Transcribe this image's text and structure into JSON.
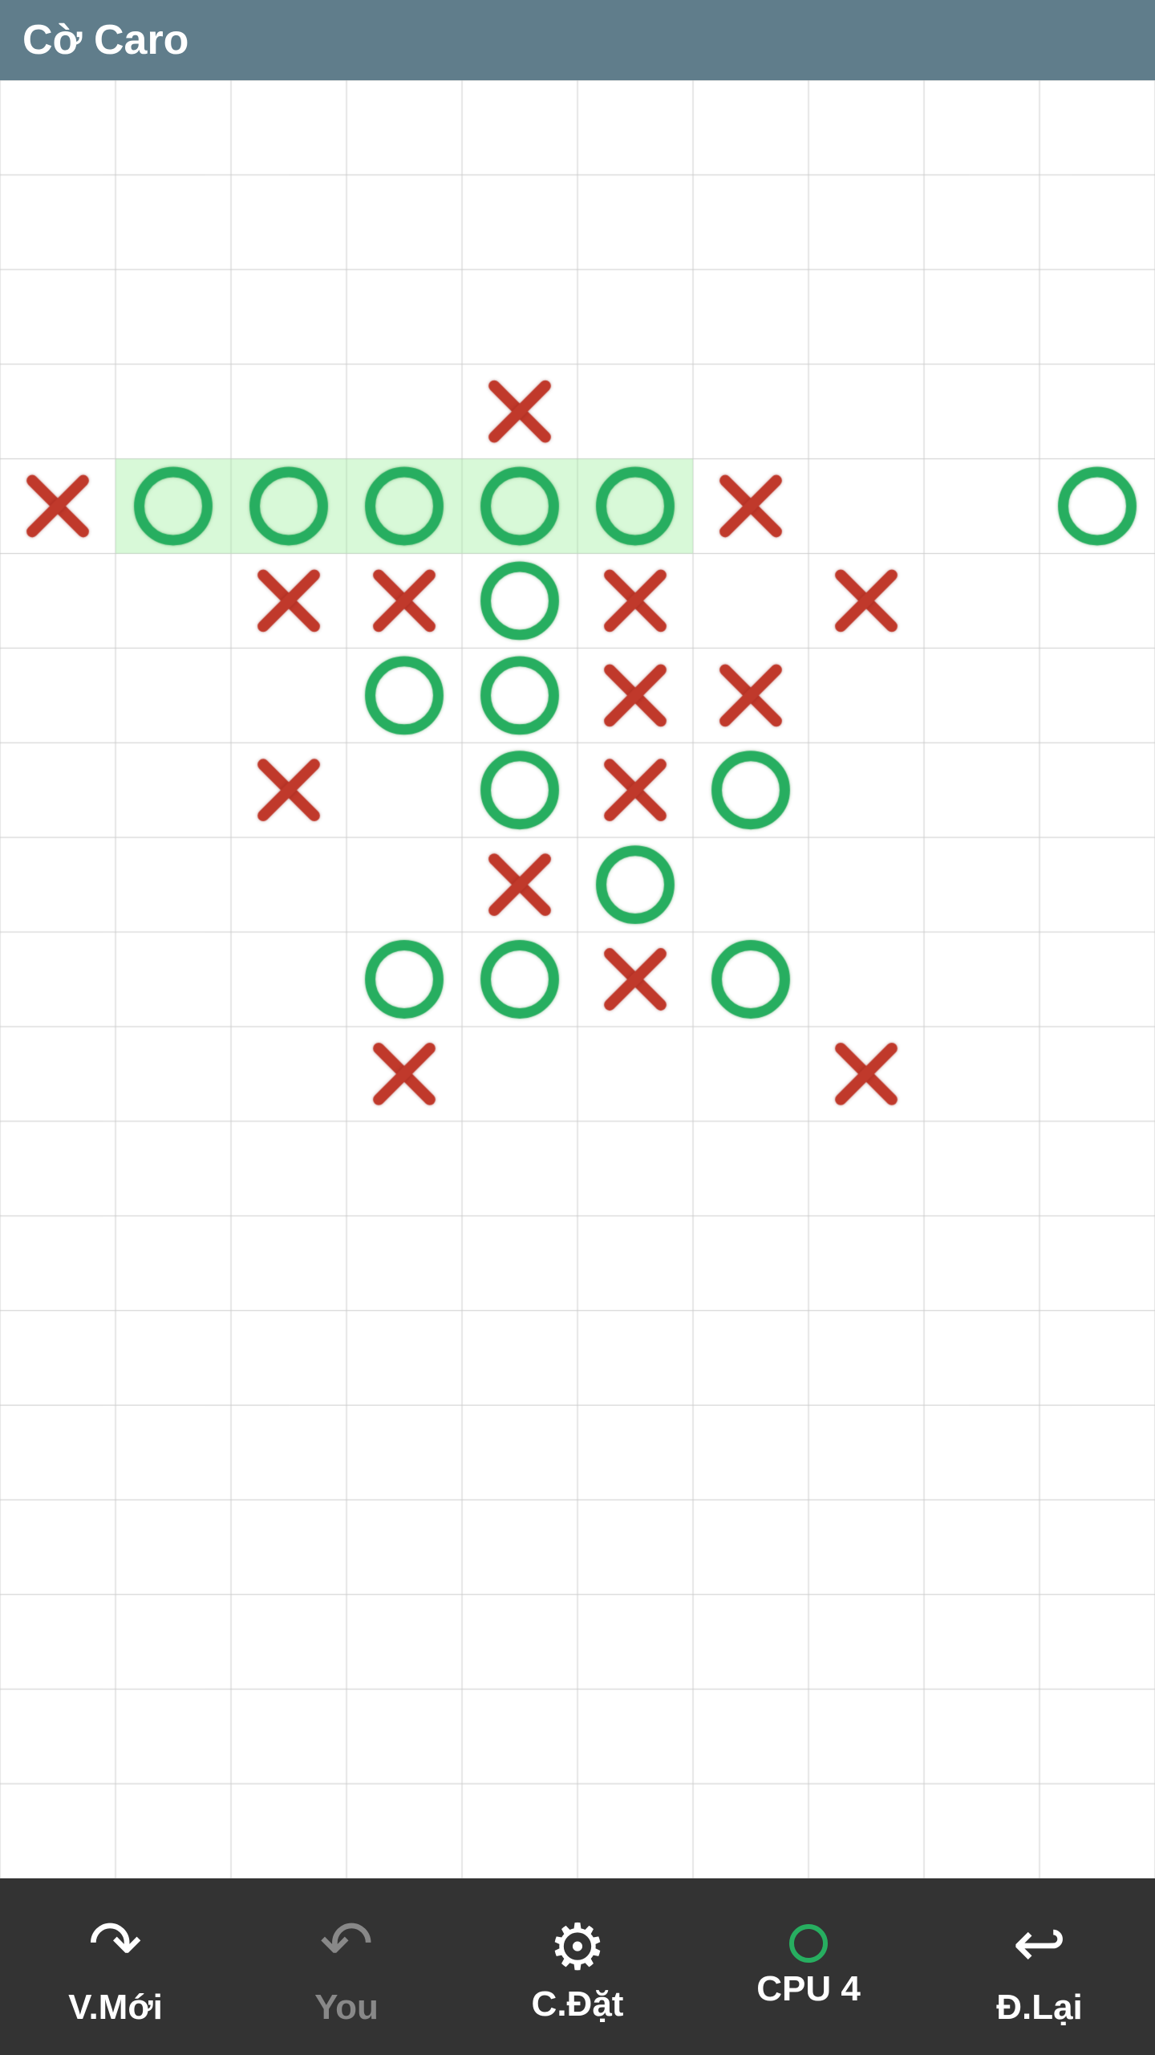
{
  "app": {
    "title": "Cờ Caro"
  },
  "board": {
    "cols": 10,
    "rows": 19,
    "cellSize": 144,
    "pieces": [
      {
        "row": 3,
        "col": 4,
        "type": "X"
      },
      {
        "row": 4,
        "col": 0,
        "type": "X"
      },
      {
        "row": 4,
        "col": 1,
        "type": "O",
        "highlight": true
      },
      {
        "row": 4,
        "col": 2,
        "type": "O",
        "highlight": true
      },
      {
        "row": 4,
        "col": 3,
        "type": "O",
        "highlight": true
      },
      {
        "row": 4,
        "col": 4,
        "type": "O",
        "highlight": true
      },
      {
        "row": 4,
        "col": 5,
        "type": "O",
        "highlight": true
      },
      {
        "row": 4,
        "col": 6,
        "type": "X"
      },
      {
        "row": 4,
        "col": 9,
        "type": "O"
      },
      {
        "row": 5,
        "col": 2,
        "type": "X"
      },
      {
        "row": 5,
        "col": 3,
        "type": "X"
      },
      {
        "row": 5,
        "col": 4,
        "type": "O"
      },
      {
        "row": 5,
        "col": 5,
        "type": "X"
      },
      {
        "row": 5,
        "col": 7,
        "type": "X"
      },
      {
        "row": 6,
        "col": 3,
        "type": "O"
      },
      {
        "row": 6,
        "col": 4,
        "type": "O"
      },
      {
        "row": 6,
        "col": 5,
        "type": "X"
      },
      {
        "row": 6,
        "col": 6,
        "type": "X"
      },
      {
        "row": 7,
        "col": 2,
        "type": "X"
      },
      {
        "row": 7,
        "col": 4,
        "type": "O"
      },
      {
        "row": 7,
        "col": 5,
        "type": "X"
      },
      {
        "row": 7,
        "col": 6,
        "type": "O"
      },
      {
        "row": 8,
        "col": 4,
        "type": "X"
      },
      {
        "row": 8,
        "col": 5,
        "type": "O"
      },
      {
        "row": 9,
        "col": 3,
        "type": "O"
      },
      {
        "row": 9,
        "col": 4,
        "type": "O"
      },
      {
        "row": 9,
        "col": 5,
        "type": "X"
      },
      {
        "row": 9,
        "col": 6,
        "type": "O"
      },
      {
        "row": 10,
        "col": 3,
        "type": "X"
      },
      {
        "row": 10,
        "col": 7,
        "type": "X"
      }
    ]
  },
  "bottomBar": {
    "buttons": [
      {
        "id": "new-game",
        "label": "V.Mới",
        "icon": "↺",
        "disabled": false
      },
      {
        "id": "you",
        "label": "You",
        "icon": "you",
        "disabled": true
      },
      {
        "id": "settings",
        "label": "C.Đặt",
        "icon": "⚙",
        "disabled": false
      },
      {
        "id": "cpu",
        "label": "CPU 4",
        "icon": "circle",
        "disabled": false
      },
      {
        "id": "undo",
        "label": "Đ.Lại",
        "icon": "↩",
        "disabled": false
      }
    ]
  }
}
